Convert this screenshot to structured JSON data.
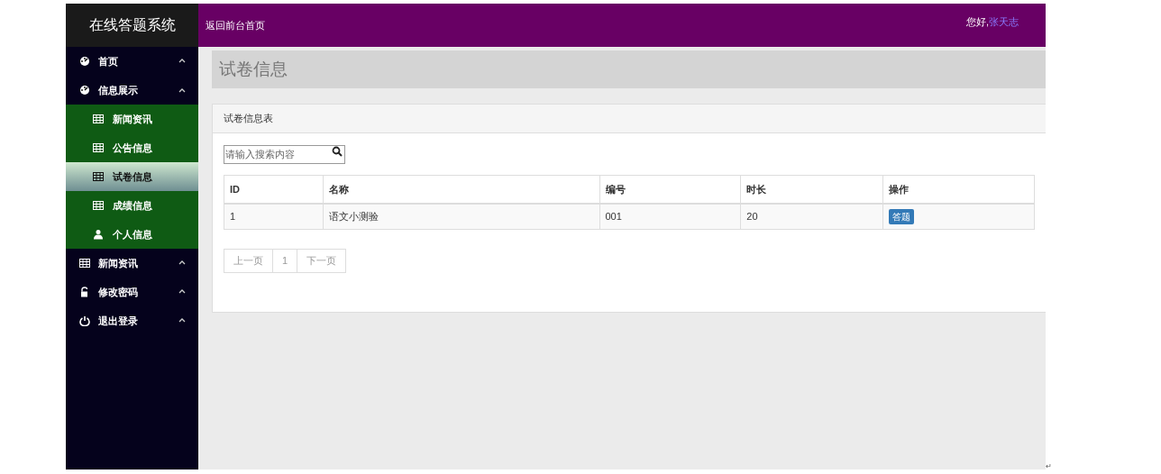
{
  "app_title": "在线答题系统",
  "header": {
    "home_link": "返回前台首页",
    "greeting": "您好,",
    "user": "张天志"
  },
  "sidebar": {
    "items": [
      {
        "label": "首页",
        "kind": "dashboard",
        "expanded": false
      },
      {
        "label": "信息展示",
        "kind": "dashboard",
        "expanded": true,
        "children": [
          {
            "label": "新闻资讯",
            "kind": "table",
            "selected": false
          },
          {
            "label": "公告信息",
            "kind": "table",
            "selected": false
          },
          {
            "label": "试卷信息",
            "kind": "table",
            "selected": true
          },
          {
            "label": "成绩信息",
            "kind": "table",
            "selected": false
          },
          {
            "label": "个人信息",
            "kind": "user",
            "selected": false
          }
        ]
      },
      {
        "label": "新闻资讯",
        "kind": "table",
        "expanded": false
      },
      {
        "label": "修改密码",
        "kind": "lock",
        "expanded": false
      },
      {
        "label": "退出登录",
        "kind": "power",
        "expanded": false
      }
    ]
  },
  "page_title": "试卷信息",
  "panel": {
    "title": "试卷信息表",
    "search": {
      "placeholder": "请输入搜索内容"
    },
    "table": {
      "columns": [
        "ID",
        "名称",
        "编号",
        "时长",
        "操作"
      ],
      "rows": [
        {
          "cells": [
            "1",
            "语文小测验",
            "001",
            "20"
          ],
          "action": "答题"
        }
      ]
    },
    "pagination": {
      "prev": "上一页",
      "pages": [
        {
          "label": "1",
          "selected": true
        }
      ],
      "next": "下一页"
    }
  },
  "paragraph_mark": "↵"
}
